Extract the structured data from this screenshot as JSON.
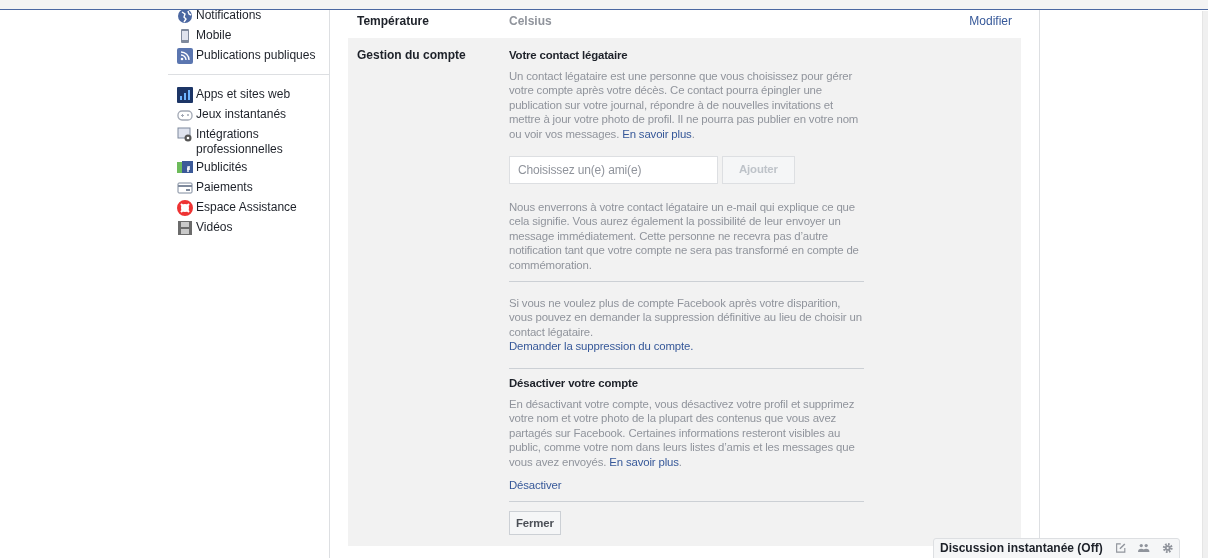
{
  "sidebar": {
    "groups": [
      [
        {
          "label": "Notifications"
        },
        {
          "label": "Mobile"
        },
        {
          "label": "Publications publiques"
        }
      ],
      [
        {
          "label": "Apps et sites web"
        },
        {
          "label": "Jeux instantanés"
        },
        {
          "label": "Intégrations professionnelles"
        },
        {
          "label": "Publicités"
        },
        {
          "label": "Paiements"
        },
        {
          "label": "Espace Assistance"
        },
        {
          "label": "Vidéos"
        }
      ]
    ]
  },
  "temperature_row": {
    "label": "Température",
    "value": "Celsius",
    "action": "Modifier"
  },
  "account": {
    "label": "Gestion du compte",
    "legacy_title": "Votre contact légataire",
    "legacy_text": "Un contact légataire est une personne que vous choisissez pour gérer votre compte après votre décès. Ce contact pourra épingler une publication sur votre journal, répondre à de nouvelles invitations et mettre à jour votre photo de profil. Il ne pourra pas publier en votre nom ou voir vos messages.",
    "legacy_link": "En savoir plus",
    "legacy_end": ".",
    "friend_field": {
      "placeholder": "Choisissez un(e) ami(e)"
    },
    "add_button": {
      "label": "Ajouter",
      "disabled": true
    },
    "email_text": "Nous enverrons à votre contact légataire un e-mail qui explique ce que cela signifie. Vous aurez également la possibilité de leur envoyer un message immédiatement. Cette personne ne recevra pas d’autre notification tant que votre compte ne sera pas transformé en compte de commémoration.",
    "delete_text": "Si vous ne voulez plus de compte Facebook après votre disparition, vous pouvez en demander la suppression définitive au lieu de choisir un contact légataire.",
    "delete_link": "Demander la suppression du compte.",
    "deactivate_title": "Désactiver votre compte",
    "deactivate_text": "En désactivant votre compte, vous désactivez votre profil et supprimez votre nom et votre photo de la plupart des contenus que vous avez partagés sur Facebook. Certaines informations resteront visibles au public, comme votre nom dans leurs listes d’amis et les messages que vous avez envoyés.",
    "deactivate_more": "En savoir plus",
    "deactivate_end": ".",
    "deactivate_link": "Désactiver",
    "close_button": "Fermer"
  },
  "chat_bar": {
    "label": "Discussion instantanée (Off)"
  }
}
